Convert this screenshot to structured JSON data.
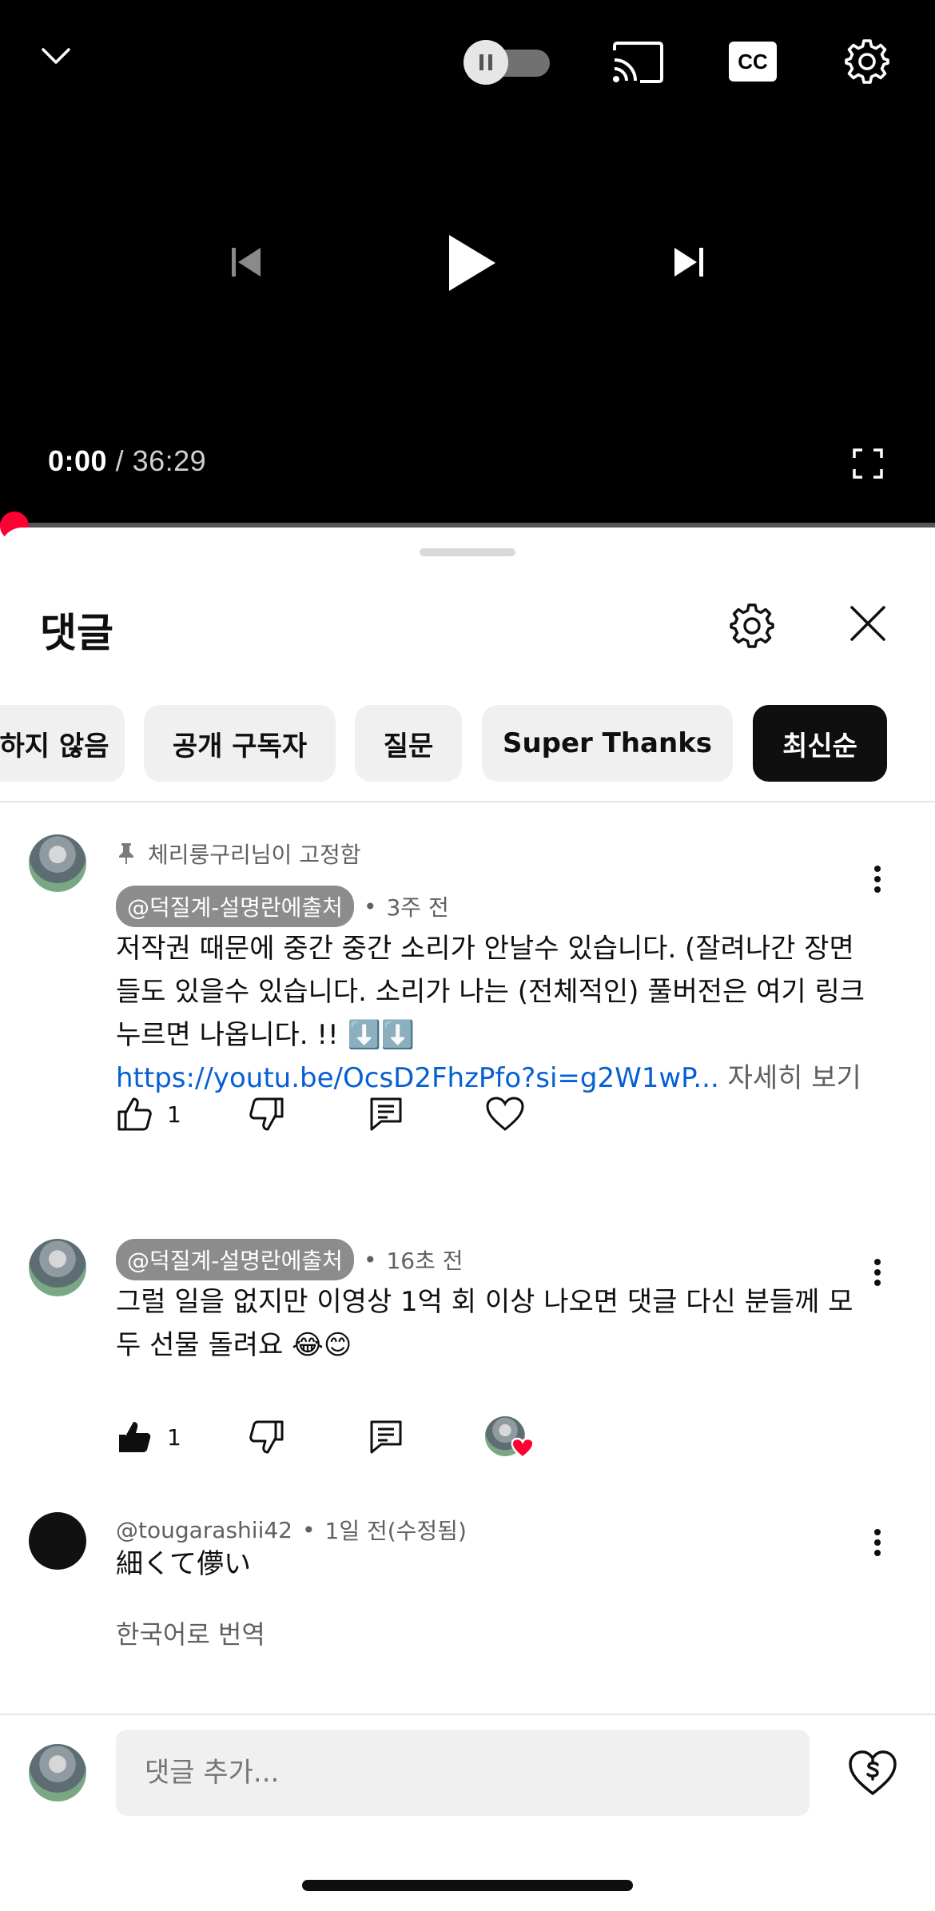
{
  "player": {
    "current_time": "0:00",
    "separator": "/",
    "duration": "36:29",
    "progress": 0.0,
    "autoplay_on": false,
    "cc_label": "CC",
    "icons": [
      "chevron-down-icon",
      "autoplay-toggle",
      "cast-icon",
      "cc-icon",
      "gear-icon",
      "previous-icon",
      "play-icon",
      "next-icon",
      "fullscreen-icon"
    ]
  },
  "sheet": {
    "title": "댓글",
    "chips": [
      {
        "label": "하지 않음",
        "active": false
      },
      {
        "label": "공개 구독자",
        "active": false
      },
      {
        "label": "질문",
        "active": false
      },
      {
        "label": "Super Thanks",
        "active": false
      },
      {
        "label": "최신순",
        "active": true
      }
    ]
  },
  "comments": [
    {
      "pinned_by": "체리룽구리님이 고정함",
      "author": "@덕질계-설명란에출처",
      "time": "3주 전",
      "text": "저작권 때문에 중간 중간 소리가 안날수 있습니다. (잘려나간 장면들도 있을수 있습니다.   소리가 나는 (전체적인) 풀버전은 여기 링크 누르면 나옵니다. !! ⬇️⬇️",
      "link": "https://youtu.be/OcsD2FhzPfo?si=g2W1wP...",
      "more_label": "자세히 보기",
      "likes": "1",
      "liked": false
    },
    {
      "author": "@덕질계-설명란에출처",
      "time": "16초 전",
      "text": "그럴 일을 없지만 이영상 1억 회 이상 나오면 댓글 다신 분들께 모두 선물 돌려요 😂😊",
      "likes": "1",
      "liked": true,
      "creator_hearted": true
    },
    {
      "author": "@tougarashii42",
      "time": "1일 전(수정됨)",
      "text": "細くて儚い",
      "translate_label": "한국어로 번역"
    }
  ],
  "compose": {
    "placeholder": "댓글 추가..."
  },
  "colors": {
    "accent_red": "#ff0033",
    "link_blue": "#065fd4",
    "chip_bg": "#f0f0f0",
    "secondary_text": "#606060"
  }
}
